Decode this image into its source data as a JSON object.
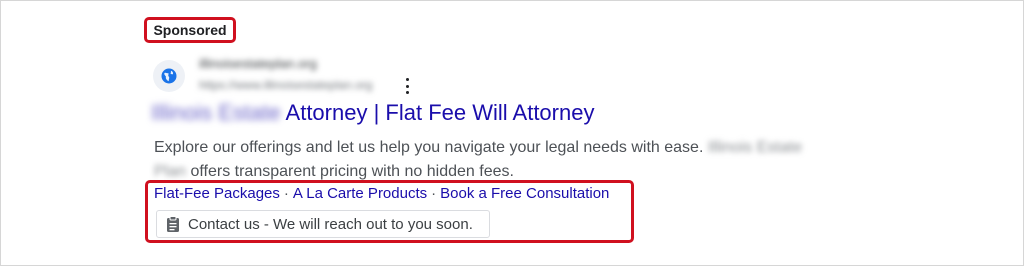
{
  "sponsored_label": "Sponsored",
  "advertiser": {
    "name": "illinoisestateplan.org",
    "url": "https://www.illinoisestateplan.org",
    "icon": "globe-icon"
  },
  "ad": {
    "headline_blurred": "Illinois Estate",
    "headline": "Attorney | Flat Fee Will Attorney",
    "description_part1": "Explore our offerings and let us help you navigate your legal needs with ease.",
    "description_blurred": "Illinois Estate Plan",
    "description_part2": "offers transparent pricing with no hidden fees."
  },
  "sitelinks": [
    "Flat-Fee Packages",
    "A La Carte Products",
    "Book a Free Consultation"
  ],
  "sitelink_separator": "·",
  "contact_chip": {
    "icon": "clipboard-icon",
    "label": "Contact us - We will reach out to you soon."
  },
  "colors": {
    "highlight_border": "#d0101f",
    "link": "#1a0dab",
    "body_text": "#4d5156"
  }
}
